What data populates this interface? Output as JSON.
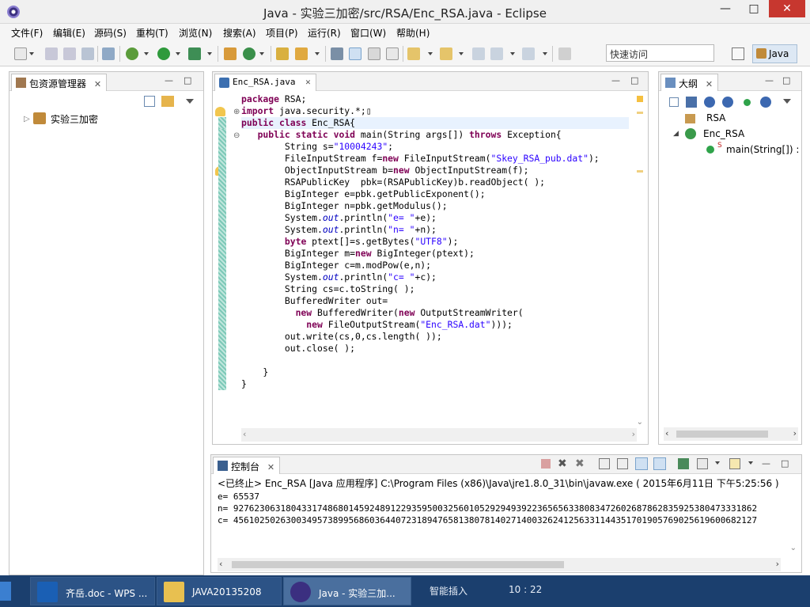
{
  "window": {
    "title": "Java  -  实验三加密/src/RSA/Enc_RSA.java  -  Eclipse",
    "minimize": "—",
    "maximize": "□",
    "close": "✕"
  },
  "menu": [
    "文件(F)",
    "编辑(E)",
    "源码(S)",
    "重构(T)",
    "浏览(N)",
    "搜索(A)",
    "项目(P)",
    "运行(R)",
    "窗口(W)",
    "帮助(H)"
  ],
  "toolbar": {
    "quick_access_placeholder": "快速访问",
    "perspective": "Java"
  },
  "package_explorer": {
    "title": "包资源管理器",
    "close": "✕",
    "project": "实验三加密"
  },
  "editor": {
    "tab": "Enc_RSA.java",
    "close": "✕",
    "lines": [
      "<span class=\"kw\">package</span> RSA;",
      "<span class=\"kw\">import</span> java.security.*;▯",
      "<span class=\"kw\">public</span> <span class=\"kw\">class</span> Enc_RSA{",
      "   <span class=\"kw\">public</span> <span class=\"kw\">static</span> <span class=\"kw\">void</span> main(String args[]) <span class=\"kw\">throws</span> Exception{",
      "        String s=<span class=\"str\">\"10004243\"</span>;",
      "        FileInputStream f=<span class=\"kw\">new</span> FileInputStream(<span class=\"str\">\"Skey_RSA_pub.dat\"</span>);",
      "        ObjectInputStream b=<span class=\"kw\">new</span> ObjectInputStream(f);",
      "        RSAPublicKey  pbk=(RSAPublicKey)b.readObject( );",
      "        BigInteger e=pbk.getPublicExponent();",
      "        BigInteger n=pbk.getModulus();",
      "        System.<span class=\"fld\">out</span>.println(<span class=\"str\">\"e= \"</span>+e);",
      "        System.<span class=\"fld\">out</span>.println(<span class=\"str\">\"n= \"</span>+n);",
      "        <span class=\"kw\">byte</span> ptext[]=s.getBytes(<span class=\"str\">\"UTF8\"</span>);",
      "        BigInteger m=<span class=\"kw\">new</span> BigInteger(ptext);",
      "        BigInteger c=m.modPow(e,n);",
      "        System.<span class=\"fld\">out</span>.println(<span class=\"str\">\"c= \"</span>+c);",
      "        String cs=c.toString( );",
      "        BufferedWriter out=",
      "          <span class=\"kw\">new</span> BufferedWriter(<span class=\"kw\">new</span> OutputStreamWriter(",
      "            <span class=\"kw\">new</span> FileOutputStream(<span class=\"str\">\"Enc_RSA.dat\"</span>)));",
      "        out.write(cs,0,cs.length( ));",
      "        out.close( );",
      "",
      "    }",
      "}"
    ]
  },
  "outline": {
    "title": "大纲",
    "close": "✕",
    "package": "RSA",
    "class": "Enc_RSA",
    "method": "main(String[]) :",
    "static_marker": "S"
  },
  "console": {
    "title": "控制台",
    "close": "✕",
    "header": "<已终止> Enc_RSA [Java 应用程序] C:\\Program Files (x86)\\Java\\jre1.8.0_31\\bin\\javaw.exe ( 2015年6月11日 下午5:25:56 )",
    "lines": [
      "e= 65537",
      "n= 9276230631804331748680145924891229359500325601052929493922365656338083472602687862835925380473331862",
      "c= 4561025026300349573899568603644072318947658138078140271400326241256331144351701905769025619600682127"
    ]
  },
  "taskbar": {
    "items": [
      "齐岳.doc - WPS ...",
      "JAVA20135208",
      "Java  -  实验三加..."
    ],
    "ime_mode": "智能插入",
    "cursor_pos": "10 : 22"
  },
  "colors": {
    "titlebar": "#f0f0f0",
    "close": "#c7372f",
    "taskbar": "#1b3f6e",
    "keyword": "#7f0055",
    "string": "#2a00ff",
    "field": "#0000c0"
  }
}
